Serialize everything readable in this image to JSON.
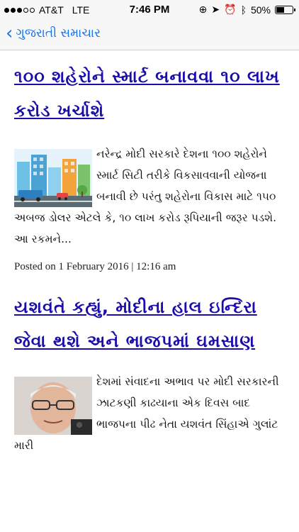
{
  "status_bar": {
    "carrier": "AT&T",
    "network": "LTE",
    "time": "7:46 PM",
    "battery": "50%",
    "battery_level": 0.5
  },
  "nav": {
    "back_label": "ગુજરાતી સમાચાર"
  },
  "articles": [
    {
      "title": "૧૦૦ શહેરોને સ્માર્ટ બનાવવા ૧૦ લાખ કરોડ ખર્ચાશે",
      "summary": "નરેન્દ્ર મોદી સરકારે દેશના ૧૦૦ શહેરોને સ્માર્ટ સિટી તરીકે વિકસાવવાની યોજના બનાવી છે પરંતુ શહેરોના વિકાસ માટે ૧૫૦ અબજ ડોલર એટલે કે, ૧૦ લાખ કરોડ રૂપિયાની જરૂર પડશે. આ રકમને...",
      "posted": "Posted on 1 February 2016 | 12:16 am"
    },
    {
      "title": "યશવંતે કહ્યું, મોદીના હાલ ઇન્દિરા જેવા થશે અને ભાજપમાં ઘમસાણ",
      "summary": "દેશમાં સંવાદના અભાવ પર મોદી સરકારની ઝાટકણી કાઢયાના એક દિવસ બાદ ભાજપના પીઢ નેતા યશવંત સિંહાએ ગુલાંટ મારી"
    }
  ]
}
